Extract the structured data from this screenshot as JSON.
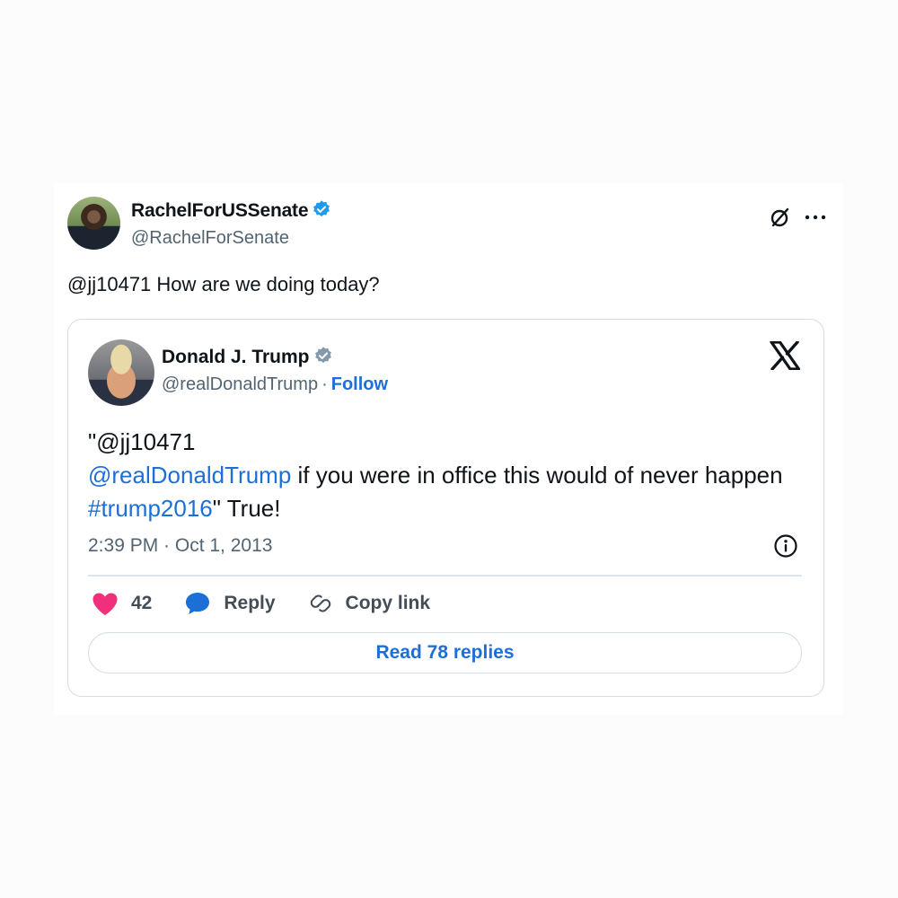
{
  "post": {
    "display_name": "RachelForUSSenate",
    "handle": "@RachelForSenate",
    "text": "@jj10471 How are we doing today?",
    "verified_color": "#1d9bf0",
    "icons": [
      "grok-icon",
      "more-icon"
    ]
  },
  "embed": {
    "display_name": "Donald J. Trump",
    "handle": "@realDonaldTrump",
    "separator": "·",
    "follow_label": "Follow",
    "verified_color": "#829aab",
    "body": {
      "part1": "\"@jj10471",
      "mention": "@realDonaldTrump",
      "part2": " if you were in office this would of never happen ",
      "hashtag": "#trump2016",
      "part3": "\"  True!"
    },
    "timestamp": "2:39 PM · Oct 1, 2013",
    "likes_count": "42",
    "reply_label": "Reply",
    "copy_link_label": "Copy link",
    "read_replies_label": "Read 78 replies",
    "accent_color": "#1d6fd8",
    "heart_color": "#f0307a"
  }
}
